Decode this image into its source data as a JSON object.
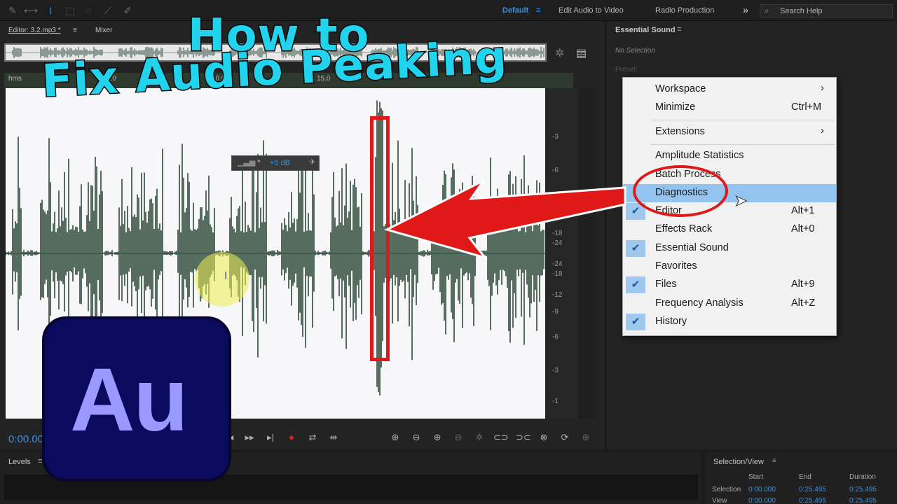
{
  "toolbar": {
    "workspaces": [
      "Default",
      "Edit Audio to Video",
      "Radio Production"
    ],
    "more": "»",
    "search_placeholder": "Search Help"
  },
  "editor": {
    "tab_editor": "Editor: 3.2.mp3 *",
    "tab_mixer": "Mixer",
    "ruler_labels": [
      "hms",
      "5.0",
      "10.0",
      "15.0"
    ],
    "db_scale": [
      "-3",
      "-6",
      "-18",
      "-24",
      "-24",
      "-18",
      "-12",
      "-9",
      "-6",
      "-3",
      "-1"
    ],
    "hud_value": "+0 dB",
    "timecode": "0:00.000"
  },
  "levels": {
    "title": "Levels"
  },
  "essential_sound": {
    "title": "Essential Sound",
    "no_selection": "No Selection",
    "preset_label": "Preset:"
  },
  "menu": {
    "items": [
      {
        "label": "Workspace",
        "shortcut": "",
        "submenu": true,
        "checked": false
      },
      {
        "label": "Minimize",
        "shortcut": "Ctrl+M",
        "submenu": false,
        "checked": false
      },
      {
        "label": "Extensions",
        "shortcut": "",
        "submenu": true,
        "checked": false
      },
      {
        "label": "Amplitude Statistics",
        "shortcut": "",
        "submenu": false,
        "checked": false
      },
      {
        "label": "Batch Process",
        "shortcut": "",
        "submenu": false,
        "checked": false
      },
      {
        "label": "Diagnostics",
        "shortcut": "",
        "submenu": false,
        "checked": false,
        "highlighted": true
      },
      {
        "label": "Editor",
        "shortcut": "Alt+1",
        "submenu": false,
        "checked": true
      },
      {
        "label": "Effects Rack",
        "shortcut": "Alt+0",
        "submenu": false,
        "checked": false
      },
      {
        "label": "Essential Sound",
        "shortcut": "",
        "submenu": false,
        "checked": true
      },
      {
        "label": "Favorites",
        "shortcut": "",
        "submenu": false,
        "checked": false
      },
      {
        "label": "Files",
        "shortcut": "Alt+9",
        "submenu": false,
        "checked": true
      },
      {
        "label": "Frequency Analysis",
        "shortcut": "Alt+Z",
        "submenu": false,
        "checked": false
      },
      {
        "label": "History",
        "shortcut": "",
        "submenu": false,
        "checked": true
      }
    ]
  },
  "selection_view": {
    "title": "Selection/View",
    "col_start": "Start",
    "col_end": "End",
    "col_duration": "Duration",
    "row_selection": "Selection",
    "row_view": "View",
    "selection_start": "0:00.000",
    "selection_end": "0:25.495",
    "selection_duration": "0:25.495",
    "view_start": "0:00.000",
    "view_end": "0:25.495",
    "view_duration": "0:25.495"
  },
  "overlay": {
    "title_line1": "How to",
    "title_line2": "Fix Audio Peaking",
    "logo_text": "Au"
  },
  "colors": {
    "accent": "#3d8fe0",
    "title": "#22d3ee",
    "annotation": "#e01818",
    "waveform": "#2d4a3a"
  }
}
